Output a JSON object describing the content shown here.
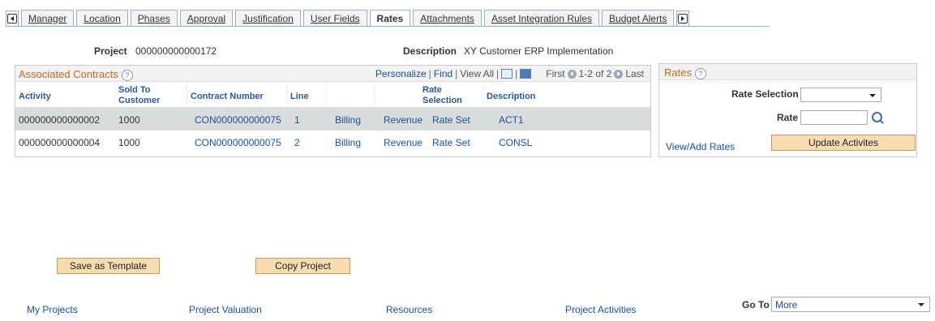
{
  "tabs": [
    {
      "label": "Manager",
      "active": false
    },
    {
      "label": "Location",
      "active": false
    },
    {
      "label": "Phases",
      "active": false
    },
    {
      "label": "Approval",
      "active": false
    },
    {
      "label": "Justification",
      "active": false
    },
    {
      "label": "User Fields",
      "active": false
    },
    {
      "label": "Rates",
      "active": true
    },
    {
      "label": "Attachments",
      "active": false
    },
    {
      "label": "Asset Integration Rules",
      "active": false
    },
    {
      "label": "Budget Alerts",
      "active": false
    }
  ],
  "header": {
    "project_label": "Project",
    "project_value": "000000000000172",
    "description_label": "Description",
    "description_value": "XY Customer ERP Implementation"
  },
  "contracts": {
    "title": "Associated Contracts",
    "nav": {
      "personalize": "Personalize",
      "find": "Find",
      "view_all": "View All",
      "first": "First",
      "range": "1-2 of 2",
      "last": "Last"
    },
    "columns": {
      "activity": "Activity",
      "sold_to_1": "Sold To",
      "sold_to_2": "Customer",
      "contract_number": "Contract Number",
      "line": "Line",
      "rate_sel_1": "Rate",
      "rate_sel_2": "Selection",
      "description": "Description"
    },
    "rows": [
      {
        "activity": "000000000000002",
        "sold_to": "1000",
        "contract": "CON000000000075",
        "line": "1",
        "billing": "Billing",
        "revenue": "Revenue",
        "rate_set": "Rate Set",
        "description": "ACT1"
      },
      {
        "activity": "000000000000004",
        "sold_to": "1000",
        "contract": "CON000000000075",
        "line": "2",
        "billing": "Billing",
        "revenue": "Revenue",
        "rate_set": "Rate Set",
        "description": "CONSL"
      }
    ]
  },
  "rates": {
    "title": "Rates",
    "rate_selection_label": "Rate Selection",
    "rate_selection_value": "",
    "rate_label": "Rate",
    "rate_value": "",
    "view_add_link": "View/Add Rates",
    "update_button": "Update Activites"
  },
  "actions": {
    "save_template": "Save as Template",
    "copy_project": "Copy Project"
  },
  "footer": {
    "links": [
      "My Projects",
      "Project Valuation",
      "Resources",
      "Project Activities"
    ],
    "goto_label": "Go To",
    "goto_value": "More"
  }
}
